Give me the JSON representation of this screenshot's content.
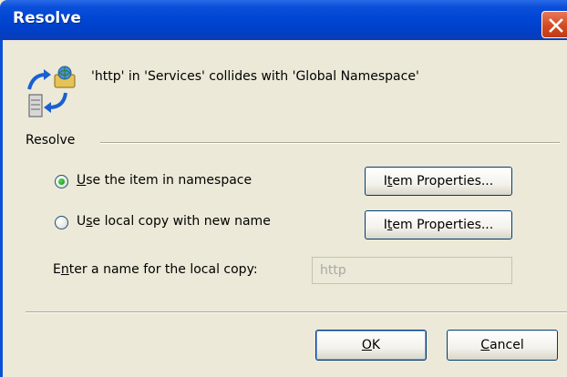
{
  "dialog": {
    "title": "Resolve",
    "message": "'http' in 'Services' collides with 'Global Namespace'",
    "group_label": "Resolve",
    "options": [
      {
        "label_prefix": "",
        "label_mnemonic": "U",
        "label_rest": "se the item in namespace",
        "checked": true
      },
      {
        "label_prefix": "U",
        "label_mnemonic": "s",
        "label_rest": "e local copy with new name",
        "checked": false
      }
    ],
    "item_properties_buttons": [
      {
        "prefix": "I",
        "mnemonic": "t",
        "rest": "em Properties..."
      },
      {
        "prefix": "I",
        "mnemonic": "t",
        "rest": "em Properties..."
      }
    ],
    "name_field": {
      "label_prefix": "E",
      "label_mnemonic": "n",
      "label_rest": "ter a name for the local copy:",
      "value": "http",
      "enabled": false
    },
    "ok_button": {
      "mnemonic": "O",
      "rest": "K"
    },
    "cancel_button": {
      "mnemonic": "C",
      "rest": "ancel"
    }
  },
  "icons": {
    "close": "close-icon",
    "message": "conflict-resolve-icon"
  },
  "colors": {
    "titlebar": "#0046d5",
    "close_button": "#d34a22",
    "dialog_bg": "#ece9d8",
    "radio_dot": "#21a121"
  }
}
